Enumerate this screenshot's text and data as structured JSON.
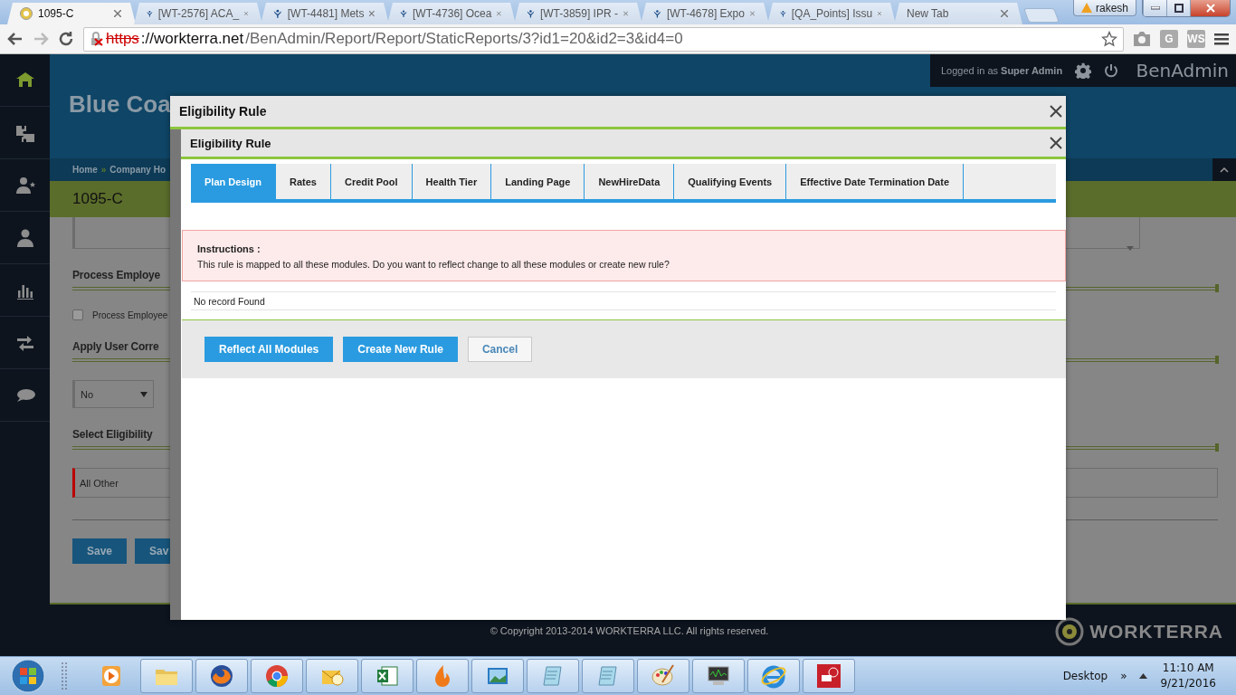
{
  "browser": {
    "tabs": [
      {
        "kind": "site",
        "title": "1095-C",
        "selected": true
      },
      {
        "kind": "tracker",
        "title": "[WT-2576] ACA_",
        "selected": false
      },
      {
        "kind": "tracker",
        "title": "[WT-4481] Mets",
        "selected": false
      },
      {
        "kind": "tracker",
        "title": "[WT-4736] Ocea",
        "selected": false
      },
      {
        "kind": "tracker",
        "title": "[WT-3859] IPR -",
        "selected": false
      },
      {
        "kind": "tracker",
        "title": "[WT-4678] Expo",
        "selected": false
      },
      {
        "kind": "tracker",
        "title": "[QA_Points] Issu",
        "selected": false
      },
      {
        "kind": "blank",
        "title": "New Tab",
        "selected": false
      }
    ],
    "profile": "rakesh",
    "address": {
      "scheme": "https",
      "host": "://workterra.net",
      "path": "/BenAdmin/Report/Report/StaticReports/3?id1=20&id2=3&id4=0"
    },
    "extensions": [
      {
        "kind": "camera"
      },
      {
        "kind": "letter",
        "label": "G"
      },
      {
        "kind": "letter",
        "label": "WS"
      }
    ]
  },
  "header": {
    "logged_in": "Logged in as",
    "user": "Super Admin",
    "app": "BenAdmin"
  },
  "sidebar": [
    {
      "kind": "home",
      "selected": true
    },
    {
      "kind": "puzzle",
      "selected": false
    },
    {
      "kind": "user-star",
      "selected": false
    },
    {
      "kind": "user",
      "selected": false
    },
    {
      "kind": "chart",
      "selected": false
    },
    {
      "kind": "transfer",
      "selected": false
    },
    {
      "kind": "chat",
      "selected": false
    }
  ],
  "page": {
    "company": "Blue Coa",
    "breadcrumb": {
      "items": [
        "Home",
        "Company Ho"
      ],
      "separator": "»"
    },
    "title": "1095-C",
    "sections": [
      {
        "kind": "checkbox",
        "heading": "Process Employe",
        "label": "Process Employee",
        "checked": false
      },
      {
        "kind": "select",
        "heading": "Apply User Corre",
        "value": "No"
      },
      {
        "kind": "field",
        "heading": "Select Eligibility",
        "value": "All Other"
      }
    ],
    "buttons": [
      "Save",
      "Sav"
    ]
  },
  "modal": {
    "title": "Eligibility Rule",
    "inner_title": "Eligibility Rule",
    "tabs": [
      {
        "label": "Plan Design",
        "selected": true
      },
      {
        "label": "Rates",
        "selected": false
      },
      {
        "label": "Credit Pool",
        "selected": false
      },
      {
        "label": "Health Tier",
        "selected": false
      },
      {
        "label": "Landing Page",
        "selected": false
      },
      {
        "label": "NewHireData",
        "selected": false
      },
      {
        "label": "Qualifying Events",
        "selected": false
      },
      {
        "label": "Effective Date Termination Date",
        "selected": false
      }
    ],
    "instructions": {
      "heading": "Instructions :",
      "text": "This rule is mapped to all these modules. Do you want to reflect change to all these modules or create new rule?"
    },
    "empty": "No record Found",
    "buttons": [
      {
        "kind": "primary",
        "label": "Reflect All Modules"
      },
      {
        "kind": "primary",
        "label": "Create New Rule"
      },
      {
        "kind": "secondary",
        "label": "Cancel"
      }
    ]
  },
  "footer": {
    "copyright": "© Copyright 2013-2014 WORKTERRA LLC. All rights reserved.",
    "logo": "WORKTERRA"
  },
  "taskbar": {
    "apps": [
      {
        "kind": "media"
      },
      {
        "kind": "folder"
      },
      {
        "kind": "firefox"
      },
      {
        "kind": "chrome"
      },
      {
        "kind": "outlook"
      },
      {
        "kind": "excel"
      },
      {
        "kind": "flame"
      },
      {
        "kind": "photo"
      },
      {
        "kind": "notepad"
      },
      {
        "kind": "notepad"
      },
      {
        "kind": "paint"
      },
      {
        "kind": "monitor"
      },
      {
        "kind": "ie"
      },
      {
        "kind": "remote"
      }
    ],
    "toolbar": "Desktop",
    "chevron": "»",
    "time": "11:10 AM",
    "date": "9/21/2016"
  }
}
